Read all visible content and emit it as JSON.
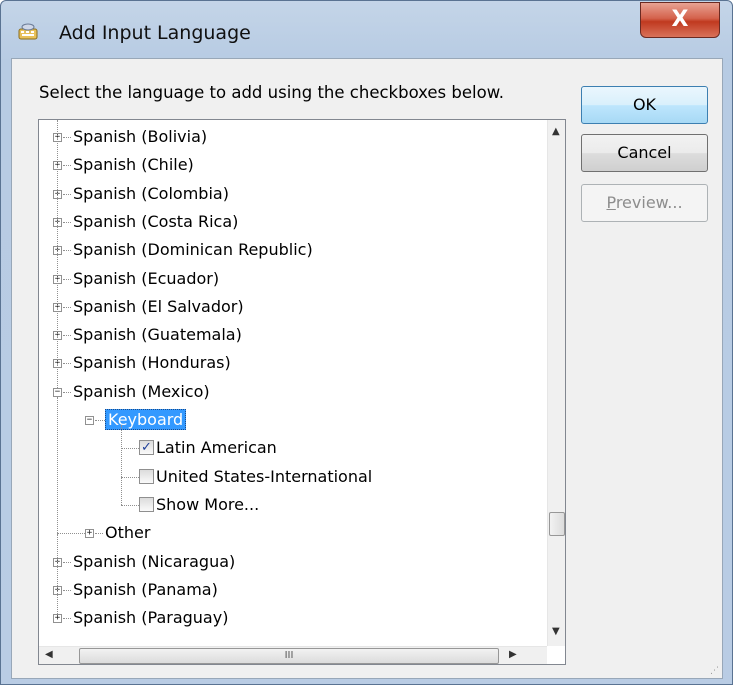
{
  "window": {
    "title": "Add Input Language",
    "close_label": "X"
  },
  "instruction": "Select the language to add using the checkboxes below.",
  "buttons": {
    "ok": "OK",
    "cancel": "Cancel",
    "preview_accel": "P",
    "preview_rest": "review..."
  },
  "tree": {
    "languages_before": [
      "Spanish (Bolivia)",
      "Spanish (Chile)",
      "Spanish (Colombia)",
      "Spanish (Costa Rica)",
      "Spanish (Dominican Republic)",
      "Spanish (Ecuador)",
      "Spanish (El Salvador)",
      "Spanish (Guatemala)",
      "Spanish (Honduras)"
    ],
    "expanded_language": "Spanish (Mexico)",
    "keyboard_node": "Keyboard",
    "keyboards": [
      {
        "label": "Latin American",
        "checked": true
      },
      {
        "label": "United States-International",
        "checked": false
      },
      {
        "label": "Show More...",
        "checked": false
      }
    ],
    "other_node": "Other",
    "languages_after": [
      "Spanish (Nicaragua)",
      "Spanish (Panama)",
      "Spanish (Paraguay)"
    ]
  },
  "scrollbars": {
    "hthumb_grip": "III"
  },
  "colors": {
    "selection": "#3399ff",
    "title_close": "#c0391f"
  }
}
